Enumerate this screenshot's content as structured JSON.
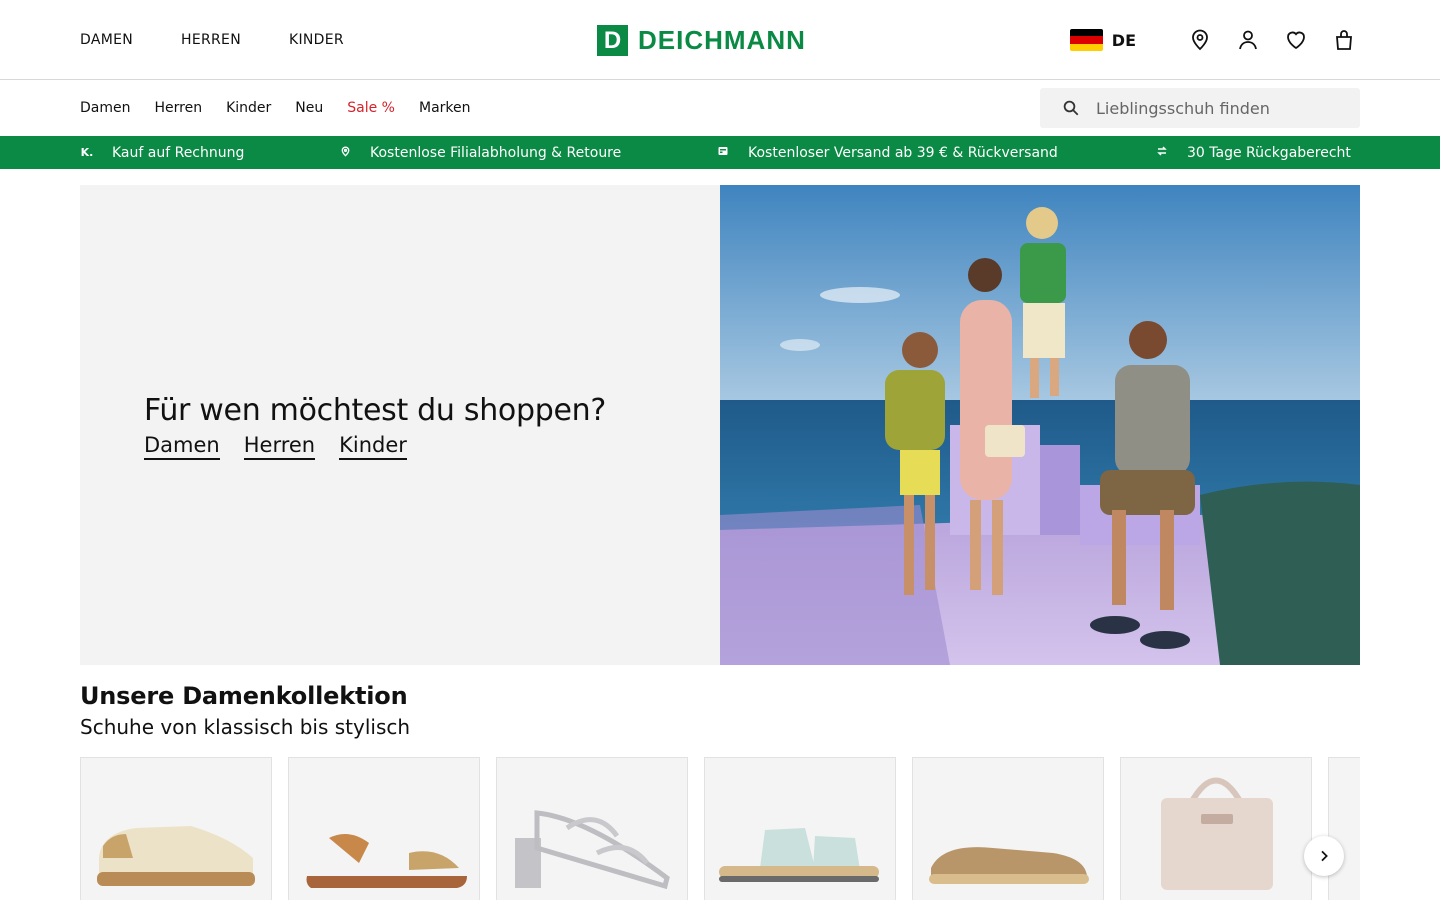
{
  "header": {
    "top_nav": [
      "DAMEN",
      "HERREN",
      "KINDER"
    ],
    "logo_mark": "D",
    "logo_text": "DEICHMANN",
    "language": "DE",
    "icons": [
      "location-pin-icon",
      "user-icon",
      "heart-icon",
      "shopping-bag-icon"
    ]
  },
  "subnav": {
    "items": [
      "Damen",
      "Herren",
      "Kinder",
      "Neu",
      "Sale %",
      "Marken"
    ],
    "search_placeholder": "Lieblingsschuh finden"
  },
  "usp": {
    "items": [
      {
        "icon": "K.",
        "text": "Kauf auf Rechnung"
      },
      {
        "icon": "pin",
        "text": "Kostenlose Filialabholung & Retoure"
      },
      {
        "icon": "truck",
        "text": "Kostenloser Versand ab 39 € & Rückversand"
      },
      {
        "icon": "return",
        "text": "30 Tage Rückgaberecht"
      }
    ]
  },
  "hero": {
    "title": "Für wen möchtest du shoppen?",
    "links": [
      "Damen",
      "Herren",
      "Kinder"
    ]
  },
  "collection": {
    "title": "Unsere Damenkollektion",
    "subtitle": "Schuhe von klassisch bis stylisch",
    "products": [
      "sneaker",
      "sandal",
      "heeled-sandal",
      "slide-sandal",
      "espadrille",
      "handbag",
      "partial-item"
    ]
  },
  "colors": {
    "brand_green": "#0a8a44",
    "sale_red": "#d6232c",
    "hero_bg": "#f3f3f3"
  }
}
